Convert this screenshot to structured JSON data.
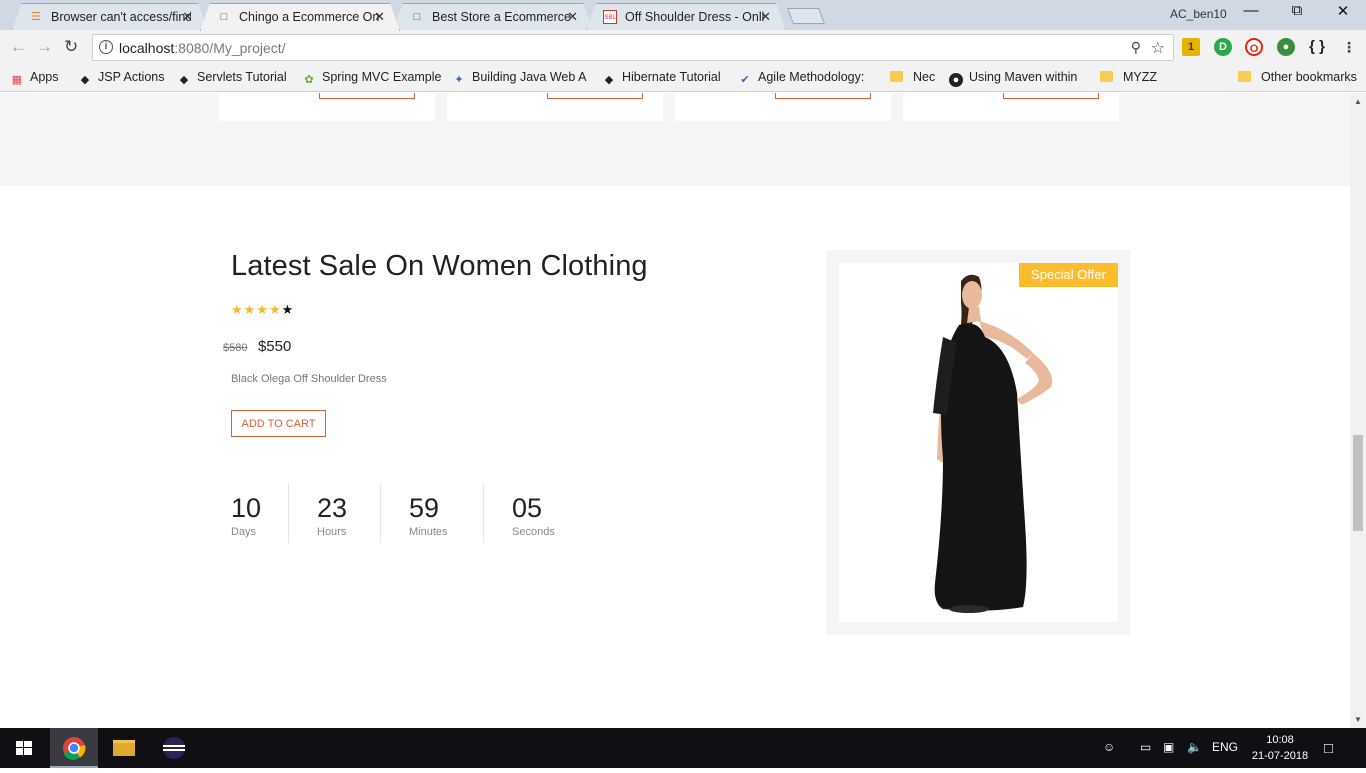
{
  "browser": {
    "tabs": [
      {
        "title": "Browser can't access/find",
        "icon": "stackoverflow-icon"
      },
      {
        "title": "Chingo a Ecommerce On",
        "icon": "page-icon"
      },
      {
        "title": "Best Store a Ecommerce",
        "icon": "page-icon"
      },
      {
        "title": "Off Shoulder Dress - Onli",
        "icon": "sbl-icon"
      }
    ],
    "profile_name": "AC_ben10",
    "url_host": "localhost",
    "url_rest": ":8080/My_project/",
    "bookmarks": [
      {
        "label": "Apps",
        "icon": "apps-grid-icon"
      },
      {
        "label": "JSP Actions",
        "icon": "diamond-icon"
      },
      {
        "label": "Servlets Tutorial",
        "icon": "diamond-icon"
      },
      {
        "label": "Spring MVC Example",
        "icon": "leaf-icon"
      },
      {
        "label": "Building Java Web A",
        "icon": "puzzle-icon"
      },
      {
        "label": "Hibernate Tutorial",
        "icon": "diamond-icon"
      },
      {
        "label": "Agile Methodology:",
        "icon": "check-icon"
      },
      {
        "label": "Nec",
        "icon": "folder-icon"
      },
      {
        "label": "Using Maven within",
        "icon": "eclipse-icon"
      },
      {
        "label": "MYZZ",
        "icon": "folder-icon"
      },
      {
        "label": "Other bookmarks",
        "icon": "folder-icon"
      }
    ],
    "extension_badge": "1"
  },
  "offer": {
    "title": "Latest Sale On Women Clothing",
    "rating": 4,
    "rating_max": 5,
    "old_price": "$580",
    "new_price": "$550",
    "product_name": "Black Olega Off Shoulder Dress",
    "add_to_cart": "ADD TO CART",
    "badge": "Special Offer",
    "countdown": [
      {
        "value": "10",
        "label": "Days"
      },
      {
        "value": "23",
        "label": "Hours"
      },
      {
        "value": "59",
        "label": "Minutes"
      },
      {
        "value": "05",
        "label": "Seconds"
      }
    ]
  },
  "taskbar": {
    "language": "ENG",
    "time": "10:08",
    "date": "21-07-2018"
  }
}
